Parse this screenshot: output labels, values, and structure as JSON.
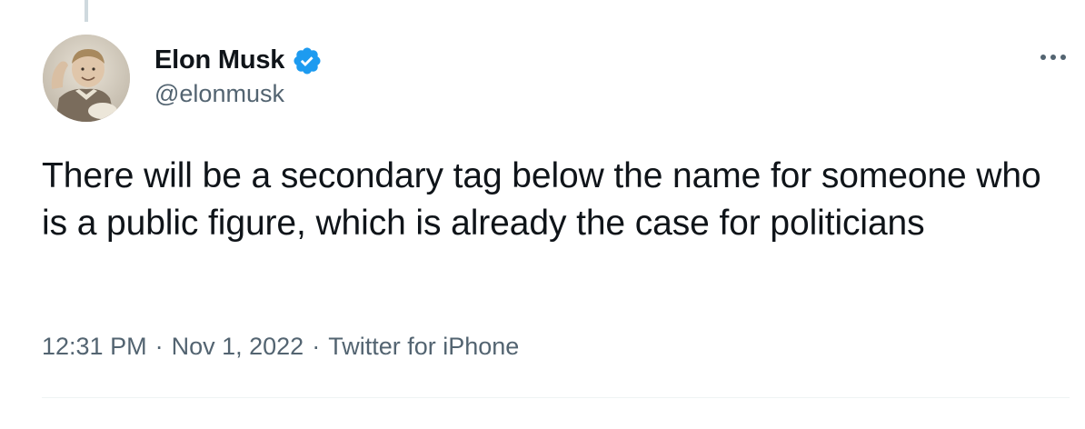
{
  "author": {
    "display_name": "Elon Musk",
    "handle": "@elonmusk",
    "avatar_icon": "child-photo-avatar",
    "verified_icon": "verified-badge-icon"
  },
  "tweet": {
    "text": "There will be a secondary tag below the name for someone who is a public figure, which is already the case for politicians",
    "time": "12:31 PM",
    "separator": "·",
    "date": "Nov 1, 2022",
    "source": "Twitter for iPhone"
  },
  "colors": {
    "verified": "#1d9bf0",
    "text_primary": "#0f1419",
    "text_secondary": "#536471",
    "thread_line": "#cfd9de",
    "divider": "#eff3f4"
  },
  "more_icon": "more-dots-icon"
}
